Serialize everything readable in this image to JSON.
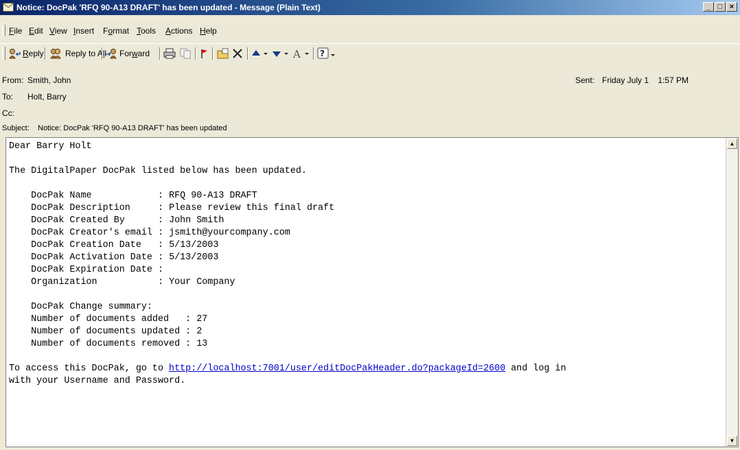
{
  "window": {
    "title": "Notice: DocPak 'RFQ 90-A13 DRAFT' has been updated - Message (Plain Text)",
    "controls": {
      "minimize": "_",
      "maximize": "□",
      "close": "×"
    }
  },
  "menu": [
    {
      "pre": "",
      "u": "F",
      "post": "ile"
    },
    {
      "pre": "",
      "u": "E",
      "post": "dit"
    },
    {
      "pre": "",
      "u": "V",
      "post": "iew"
    },
    {
      "pre": "",
      "u": "I",
      "post": "nsert"
    },
    {
      "pre": "F",
      "u": "o",
      "post": "rmat"
    },
    {
      "pre": "",
      "u": "T",
      "post": "ools"
    },
    {
      "pre": "",
      "u": "A",
      "post": "ctions"
    },
    {
      "pre": "",
      "u": "H",
      "post": "elp"
    }
  ],
  "toolbar": {
    "reply": {
      "pre": "",
      "u": "R",
      "post": "eply"
    },
    "reply_all": {
      "pre": "Reply to A",
      "u": "l",
      "post": "l"
    },
    "forward": {
      "pre": "For",
      "u": "w",
      "post": "ard"
    }
  },
  "header": {
    "from_label": "From:",
    "from_value": "Smith, John",
    "to_label": "To:",
    "to_value": "Holt, Barry",
    "cc_label": "Cc:",
    "cc_value": "",
    "subject_label": "Subject:",
    "subject_value": "Notice: DocPak 'RFQ 90-A13 DRAFT' has been updated",
    "sent_label": "Sent:",
    "sent_value": "Friday July 1    1:57 PM"
  },
  "body": {
    "greeting": "Dear Barry Holt",
    "intro": "The DigitalPaper DocPak listed below has been updated.",
    "fields": [
      {
        "label": "DocPak Name            ",
        "value": "RFQ 90-A13 DRAFT"
      },
      {
        "label": "DocPak Description     ",
        "value": "Please review this final draft"
      },
      {
        "label": "DocPak Created By      ",
        "value": "John Smith"
      },
      {
        "label": "DocPak Creator's email ",
        "value": "jsmith@yourcompany.com"
      },
      {
        "label": "DocPak Creation Date   ",
        "value": "5/13/2003"
      },
      {
        "label": "DocPak Activation Date ",
        "value": "5/13/2003"
      },
      {
        "label": "DocPak Expiration Date ",
        "value": ""
      },
      {
        "label": "Organization           ",
        "value": "Your Company"
      }
    ],
    "summary_heading": "DocPak Change summary:",
    "summary": [
      {
        "label": "Number of documents added   ",
        "value": "27"
      },
      {
        "label": "Number of documents updated ",
        "value": "2"
      },
      {
        "label": "Number of documents removed ",
        "value": "13"
      }
    ],
    "access_pre": "To access this DocPak, go to ",
    "access_link": "http://localhost:7001/user/editDocPakHeader.do?packageId=2600",
    "access_post": " and log in",
    "access_line2": "with your Username and Password."
  },
  "colors": {
    "titlebar_start": "#0a246a",
    "titlebar_end": "#a6caf0",
    "chrome": "#ece9d8",
    "link": "#0000cc"
  },
  "icons": [
    "envelope-icon",
    "reply-icon",
    "reply-all-icon",
    "forward-icon",
    "print-icon",
    "copy-icon",
    "flag-icon",
    "move-to-folder-icon",
    "delete-icon",
    "previous-item-icon",
    "next-item-icon",
    "address-book-icon",
    "help-icon"
  ]
}
